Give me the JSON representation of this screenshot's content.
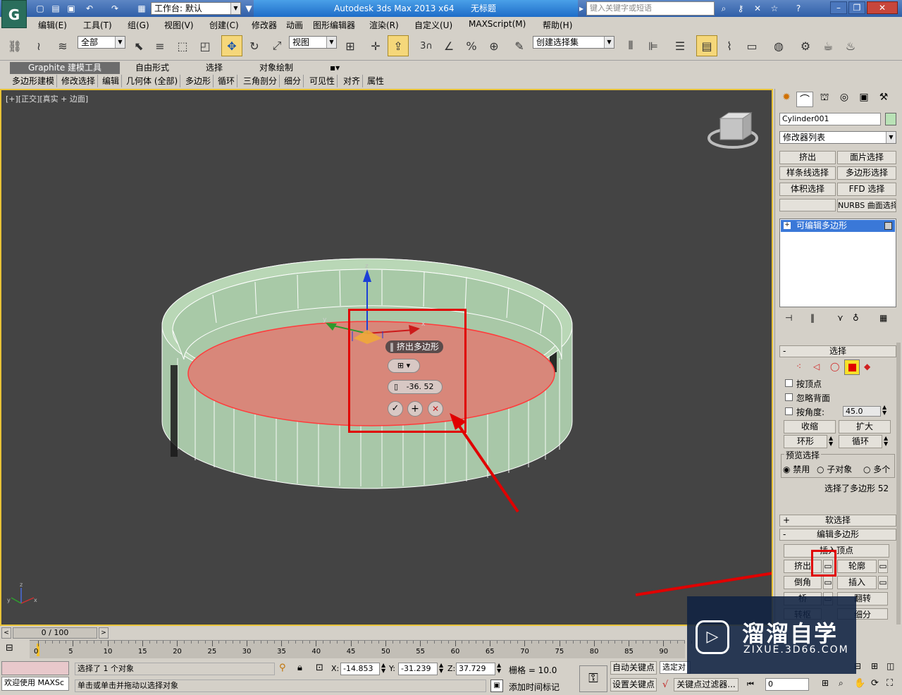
{
  "title_bar": {
    "workspace_label": "工作台: 默认",
    "app_title": "Autodesk 3ds Max  2013 x64",
    "doc_title": "无标题",
    "search_placeholder": "键入关键字或短语"
  },
  "menu": [
    "编辑(E)",
    "工具(T)",
    "组(G)",
    "视图(V)",
    "创建(C)",
    "修改器",
    "动画",
    "图形编辑器",
    "渲染(R)",
    "自定义(U)",
    "MAXScript(M)",
    "帮助(H)"
  ],
  "toolbar": {
    "filter_select": "全部",
    "ref_coord": "视图",
    "named_selection": "创建选择集",
    "snap_label": "3"
  },
  "ribbon": {
    "tabs": [
      "Graphite 建模工具",
      "自由形式",
      "选择",
      "对象绘制"
    ],
    "subtabs": [
      "多边形建模",
      "修改选择",
      "编辑",
      "几何体 (全部)",
      "多边形",
      "循环",
      "三角剖分",
      "细分",
      "可见性",
      "对齐",
      "属性"
    ]
  },
  "viewport": {
    "label": "[+][正交][真实 + 边面]",
    "caddy": {
      "title": "挤出多边形",
      "value": "-36. 52"
    }
  },
  "panel": {
    "object_name": "Cylinder001",
    "modifier_list": "修改器列表",
    "quick_buttons": [
      "挤出",
      "面片选择",
      "样条线选择",
      "多边形选择",
      "体积选择",
      "FFD 选择",
      "",
      "NURBS 曲面选择"
    ],
    "stack_item": "可编辑多边形",
    "selection": {
      "header": "选择",
      "by_vertex": "按顶点",
      "ignore_backfacing": "忽略背面",
      "by_angle": "按角度:",
      "angle_value": "45.0",
      "shrink": "收缩",
      "grow": "扩大",
      "ring": "环形",
      "loop": "循环",
      "preview_label": "预览选择",
      "preview_options": [
        "禁用",
        "子对象",
        "多个"
      ],
      "status": "选择了多边形 52"
    },
    "soft_selection": "软选择",
    "edit_poly": {
      "header": "编辑多边形",
      "insert_vertex": "插入顶点",
      "extrude": "挤出",
      "outline": "轮廓",
      "bevel": "倒角",
      "inset": "插入",
      "bridge": "桥",
      "flip": "翻转",
      "hinge": "转枢",
      "subdivide": "细分"
    }
  },
  "timeline": {
    "frame_counter": "0 / 100",
    "ticks": [
      "0",
      "5",
      "10",
      "15",
      "20",
      "25",
      "30",
      "35",
      "40",
      "45",
      "50",
      "55",
      "60",
      "65",
      "70",
      "75",
      "80",
      "85",
      "90"
    ]
  },
  "status": {
    "welcome": "欢迎使用 MAXSc",
    "selected": "选择了 1 个对象",
    "hint": "单击或单击并拖动以选择对象",
    "x": "-14.853",
    "y": "-31.239",
    "z": "37.729",
    "grid": "栅格 = 10.0",
    "auto_key": "自动关键点",
    "selected_object": "选定对",
    "set_key": "设置关键点",
    "key_filters": "关键点过滤器...",
    "add_time_tag": "添加时间标记",
    "frame": "0"
  },
  "watermark": {
    "brand": "溜溜自学",
    "url": "ZIXUE.3D66.COM"
  }
}
